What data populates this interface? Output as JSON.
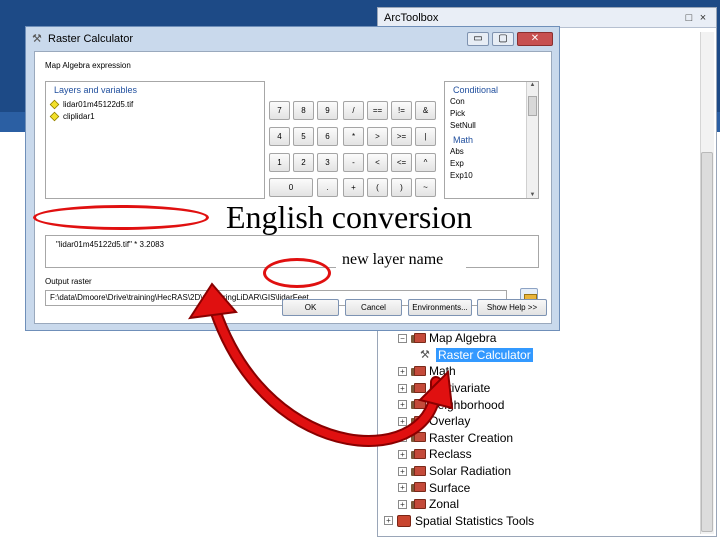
{
  "arctoolbox": {
    "title": "ArcToolbox",
    "controls": [
      "□",
      "×"
    ],
    "tree": [
      {
        "label": "Map Algebra",
        "expander": "−",
        "kind": "toolset",
        "indent": 1
      },
      {
        "label": "Raster Calculator",
        "expander": "",
        "kind": "tool",
        "indent": 2,
        "selected": true
      },
      {
        "label": "Math",
        "expander": "+",
        "kind": "toolset",
        "indent": 1
      },
      {
        "label": "Multivariate",
        "expander": "+",
        "kind": "toolset",
        "indent": 1
      },
      {
        "label": "Neighborhood",
        "expander": "+",
        "kind": "toolset",
        "indent": 1
      },
      {
        "label": "Overlay",
        "expander": "+",
        "kind": "toolset",
        "indent": 1
      },
      {
        "label": "Raster Creation",
        "expander": "+",
        "kind": "toolset",
        "indent": 1
      },
      {
        "label": "Reclass",
        "expander": "+",
        "kind": "toolset",
        "indent": 1
      },
      {
        "label": "Solar Radiation",
        "expander": "+",
        "kind": "toolset",
        "indent": 1
      },
      {
        "label": "Surface",
        "expander": "+",
        "kind": "toolset",
        "indent": 1
      },
      {
        "label": "Zonal",
        "expander": "+",
        "kind": "toolset",
        "indent": 1
      },
      {
        "label": "Spatial Statistics Tools",
        "expander": "+",
        "kind": "toolbox",
        "indent": 0
      }
    ]
  },
  "raster_calculator": {
    "title": "Raster Calculator",
    "window_buttons": [
      "▭",
      "▢",
      "✕"
    ],
    "section_label": "Map Algebra expression",
    "layers_header": "Layers and variables",
    "layers": [
      "lidar01m45122d5.tif",
      "cliplidar1"
    ],
    "keypad_rows": [
      [
        "7",
        "8",
        "9",
        "/",
        "==",
        "!=",
        "&"
      ],
      [
        "4",
        "5",
        "6",
        "*",
        ">",
        ">=",
        "|"
      ],
      [
        "1",
        "2",
        "3",
        "-",
        "<",
        "<=",
        "^"
      ],
      [
        "0",
        ".",
        "+",
        "(",
        ")",
        "~"
      ]
    ],
    "conditional_header": "Conditional",
    "conditional_items": [
      "Con",
      "Pick",
      "SetNull"
    ],
    "math_header": "Math",
    "math_items": [
      "Abs",
      "Exp",
      "Exp10"
    ],
    "expression": "\"lidar01m45122d5.tif\" * 3.2083",
    "output_label": "Output raster",
    "output_value": "F:\\data\\Dmoore\\Drive\\training\\HecRAS\\2D\\preparingLiDAR\\GIS\\lidarFeet",
    "buttons": {
      "ok": "OK",
      "cancel": "Cancel",
      "environments": "Environments...",
      "show_help": "Show Help >>"
    }
  },
  "annotations": {
    "english_conversion": "English conversion",
    "new_layer_name": "new layer name"
  },
  "colors": {
    "slide_band": "#1d4a86",
    "annotation_red": "#e01010",
    "selection_blue": "#3399ff"
  }
}
